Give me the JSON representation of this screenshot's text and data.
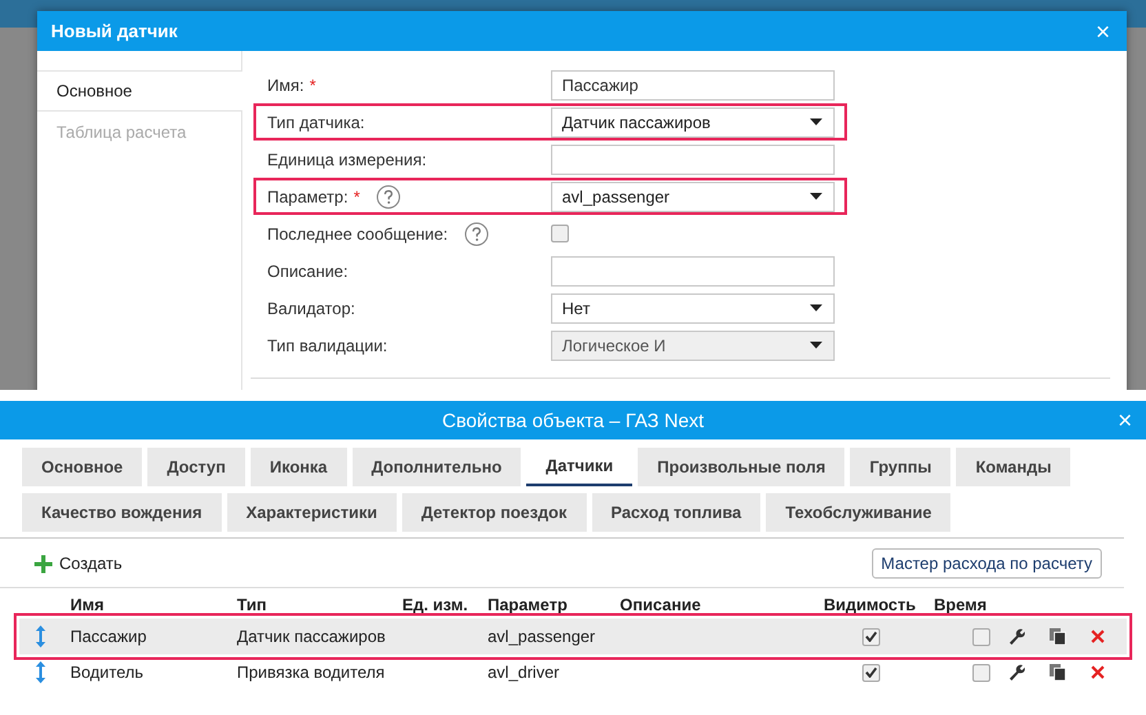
{
  "dialog": {
    "title": "Новый датчик",
    "close": "×",
    "tabs": [
      {
        "label": "Основное",
        "selected": true
      },
      {
        "label": "Таблица расчета",
        "selected": false
      }
    ],
    "fields": [
      {
        "kind": "text",
        "label": "Имя:",
        "required": "*",
        "help": false,
        "highlighted": false,
        "value": "Пассажир"
      },
      {
        "kind": "select",
        "label": "Тип датчика:",
        "help": false,
        "highlighted": true,
        "value": "Датчик пассажиров",
        "disabled": false
      },
      {
        "kind": "text",
        "label": "Единица измерения:",
        "help": false,
        "highlighted": false
      },
      {
        "kind": "select",
        "label": "Параметр:",
        "required": "*",
        "help": true,
        "highlighted": true,
        "value": "avl_passenger",
        "disabled": false
      },
      {
        "kind": "checkbox",
        "label": "Последнее сообщение:",
        "help": true,
        "highlighted": false,
        "checked": false
      },
      {
        "kind": "text",
        "label": "Описание:",
        "help": false,
        "highlighted": false
      },
      {
        "kind": "select",
        "label": "Валидатор:",
        "help": false,
        "highlighted": false,
        "value": "Нет",
        "disabled": false
      },
      {
        "kind": "select",
        "label": "Тип валидации:",
        "help": false,
        "highlighted": false,
        "value": "Логическое И",
        "disabled": true
      }
    ]
  },
  "properties": {
    "title": "Свойства объекта – ГАЗ Next",
    "close": "×",
    "tab_rows": [
      {
        "tabs": [
          {
            "label": "Основное",
            "selected": false
          },
          {
            "label": "Доступ",
            "selected": false
          },
          {
            "label": "Иконка",
            "selected": false
          },
          {
            "label": "Дополнительно",
            "selected": false
          },
          {
            "label": "Датчики",
            "selected": true
          },
          {
            "label": "Произвольные поля",
            "selected": false
          },
          {
            "label": "Группы",
            "selected": false
          },
          {
            "label": "Команды",
            "selected": false
          }
        ]
      },
      {
        "tabs": [
          {
            "label": "Качество вождения",
            "selected": false
          },
          {
            "label": "Характеристики",
            "selected": false
          },
          {
            "label": "Детектор поездок",
            "selected": false
          },
          {
            "label": "Расход топлива",
            "selected": false
          },
          {
            "label": "Техобслуживание",
            "selected": false
          }
        ]
      }
    ],
    "toolbar": {
      "create": "Создать",
      "wizard": "Мастер расхода по расчету"
    },
    "table": {
      "columns": [
        "Имя",
        "Тип",
        "Ед. изм.",
        "Параметр",
        "Описание",
        "Видимость",
        "Время"
      ],
      "rows": [
        {
          "name": "Пассажир",
          "type": "Датчик пассажиров",
          "parameter": "avl_passenger",
          "visible": true,
          "time": false,
          "selected": true,
          "highlighted": true
        },
        {
          "name": "Водитель",
          "type": "Привязка водителя",
          "parameter": "avl_driver",
          "visible": true,
          "time": false,
          "selected": false,
          "highlighted": false
        }
      ]
    }
  }
}
